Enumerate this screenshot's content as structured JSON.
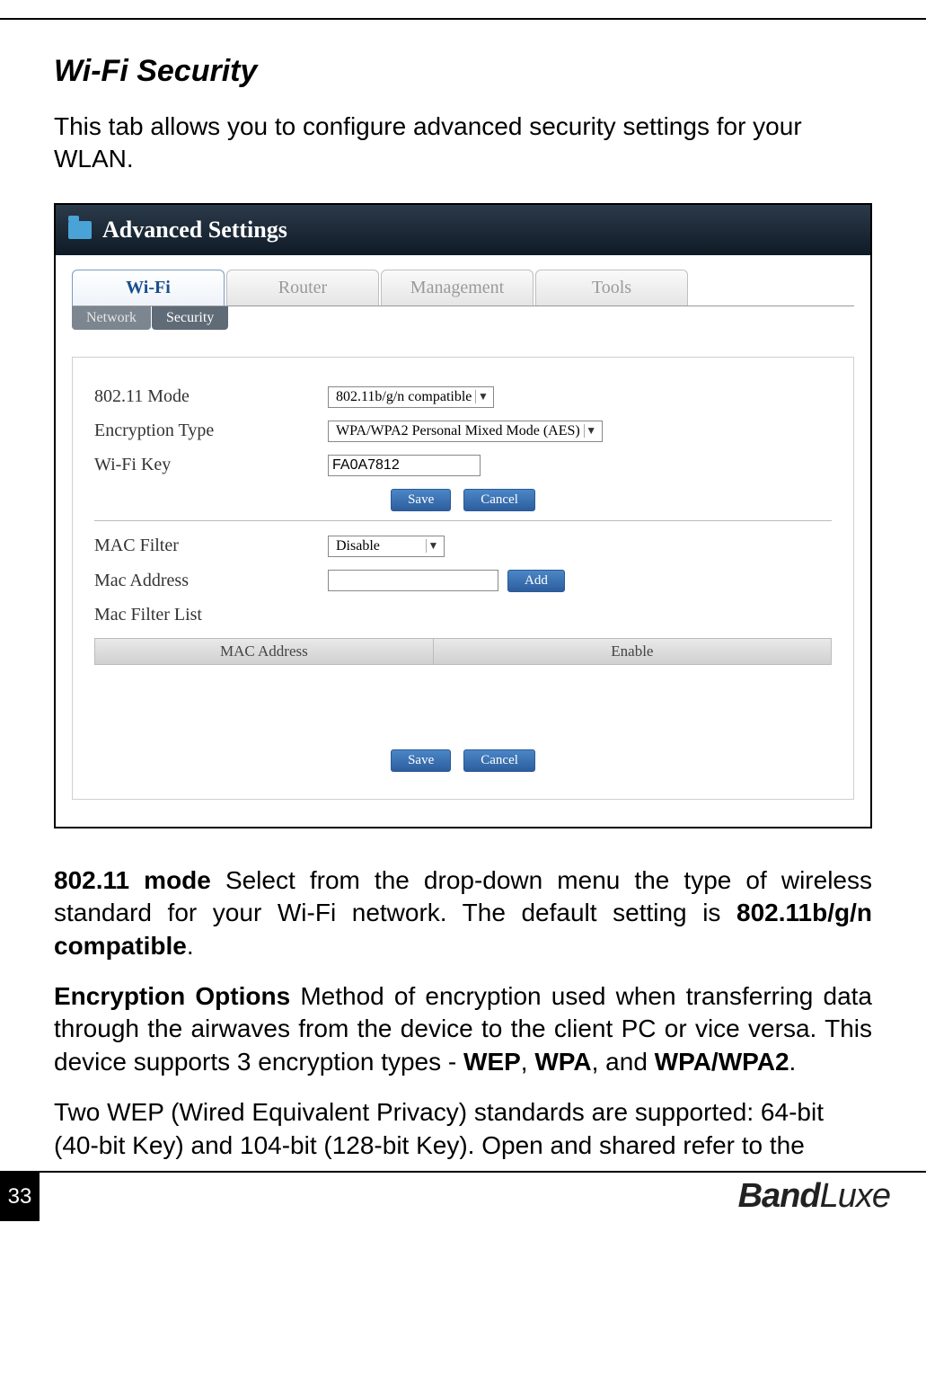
{
  "page": {
    "number": "33",
    "brand_prefix": "Band",
    "brand_suffix": "Luxe"
  },
  "doc": {
    "heading": "Wi-Fi Security",
    "intro": "This tab allows you to configure advanced security settings for your WLAN.",
    "para_mode_label": "802.11 mode",
    "para_mode_text": " Select from the drop-down menu the type of wireless standard for your Wi-Fi network. The default setting is ",
    "para_mode_bold_tail": "802.11b/g/n compatible",
    "para_mode_period": ".",
    "para_enc_label": "Encryption Options",
    "para_enc_text": " Method of encryption used when transferring data through the airwaves from the device to the client PC or vice versa. This device supports 3 encryption types - ",
    "enc_t1": "WEP",
    "enc_sep1": ", ",
    "enc_t2": "WPA",
    "enc_sep2": ", and ",
    "enc_t3": "WPA/WPA2",
    "enc_period": ".",
    "para_wep": "Two WEP (Wired Equivalent Privacy) standards are supported: 64-bit (40-bit Key) and 104-bit (128-bit Key). Open and shared refer to the"
  },
  "ui": {
    "window_title": "Advanced Settings",
    "main_tabs": [
      "Wi-Fi",
      "Router",
      "Management",
      "Tools"
    ],
    "sub_tabs": [
      "Network",
      "Security"
    ],
    "labels": {
      "mode": "802.11 Mode",
      "enc": "Encryption Type",
      "key": "Wi-Fi Key",
      "macfilter": "MAC Filter",
      "macaddr": "Mac Address",
      "maclist": "Mac Filter List"
    },
    "values": {
      "mode": "802.11b/g/n compatible",
      "enc": "WPA/WPA2 Personal Mixed Mode (AES)",
      "key": "FA0A7812",
      "macfilter": "Disable",
      "macaddr": ""
    },
    "buttons": {
      "save": "Save",
      "cancel": "Cancel",
      "add": "Add"
    },
    "table_headers": {
      "mac": "MAC Address",
      "enable": "Enable"
    }
  }
}
